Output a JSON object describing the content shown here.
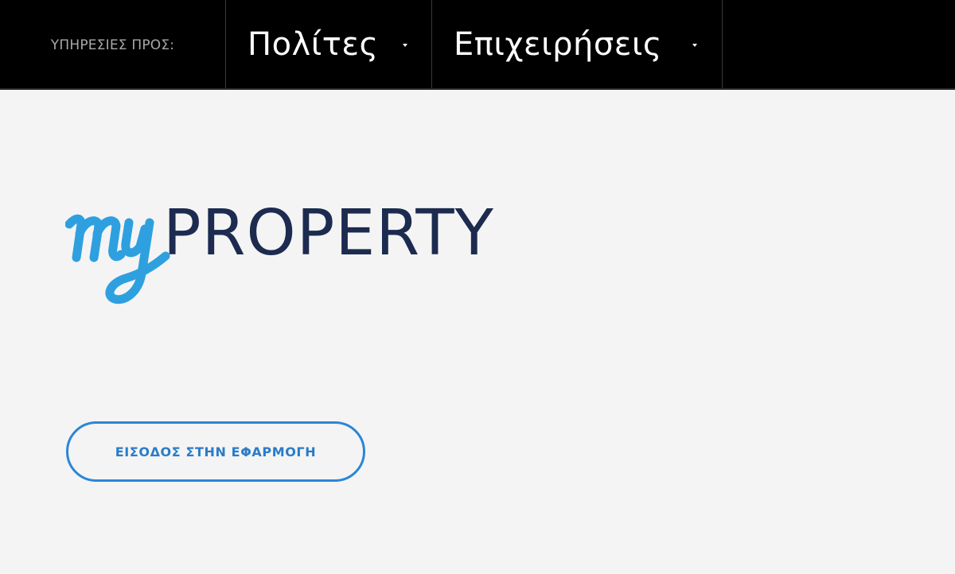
{
  "topbar": {
    "services_label": "ΥΠΗΡΕΣΙΕΣ ΠΡΟΣ:",
    "nav": [
      {
        "label": "Πολίτες",
        "icon": "caret-down-icon"
      },
      {
        "label": "Επιχειρήσεις",
        "icon": "caret-down-icon"
      }
    ]
  },
  "logo": {
    "script_part": "my",
    "text_part": "PROPERTY",
    "script_color": "#2ea0e0",
    "text_color": "#1c2b4f"
  },
  "login_button": {
    "label": "ΕΙΣΟΔΟΣ ΣΤΗΝ ΕΦΑΡΜΟΓΗ",
    "color": "#2b86d6"
  },
  "colors": {
    "topbar": "#000000",
    "background": "#f4f4f4"
  }
}
